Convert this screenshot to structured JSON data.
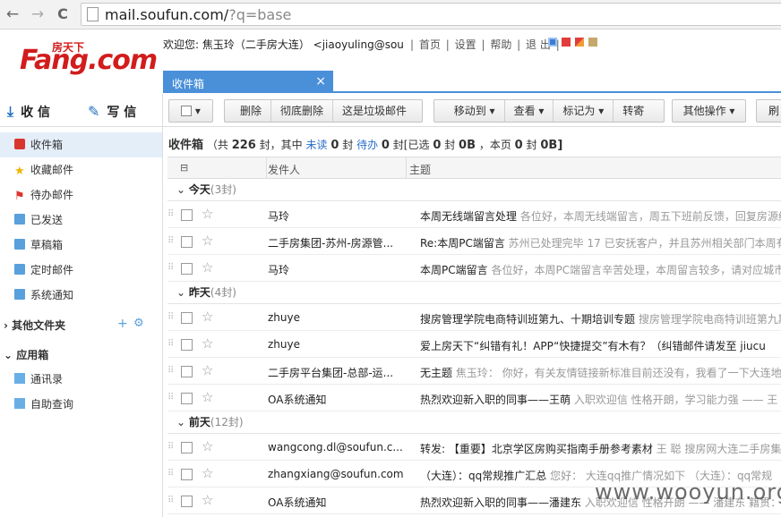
{
  "browser": {
    "url": "mail.soufun.com/",
    "url_query": "?q=base",
    "back": "←",
    "forward": "→",
    "reload": "C"
  },
  "logo": {
    "text": "Fang.com",
    "small": "房天下"
  },
  "header": {
    "welcome": "欢迎您: 焦玉玲（二手房大连） <jiaoyuling@sou",
    "links": [
      "首页",
      "设置",
      "帮助",
      "退 出"
    ],
    "sep": "|"
  },
  "tab": {
    "label": "收件箱",
    "close": "×"
  },
  "compose": {
    "receive": "收 信",
    "write": "写 信"
  },
  "sidebar": {
    "items": [
      "收件箱",
      "收藏邮件",
      "待办邮件",
      "已发送",
      "草稿箱",
      "定时邮件",
      "系统通知"
    ],
    "other_folders": "其他文件夹",
    "other_add": "+",
    "apps": "应用箱",
    "app_items": [
      "通讯录",
      "自助查询"
    ]
  },
  "toolbar": {
    "delete": "删除",
    "purge": "彻底删除",
    "spam": "这是垃圾邮件",
    "move": "移动到",
    "view": "查看",
    "mark": "标记为",
    "forward": "转寄",
    "more": "其他操作",
    "refresh": "刷"
  },
  "summary": {
    "title": "收件箱",
    "a": "（共",
    "total": "226",
    "b": "封，其中",
    "unread_l": "未读",
    "unread": "0",
    "c": "封",
    "todo_l": "待办",
    "todo": "0",
    "d": "封",
    "e": "[已选",
    "sel": "0",
    "f": "封",
    "size_sel": "0B",
    "g": "，本页",
    "page": "0",
    "h": "封",
    "size_page": "0B]"
  },
  "columns": {
    "sender": "发件人",
    "subject": "主题"
  },
  "groups": [
    {
      "label": "今天",
      "count": "(3封)"
    },
    {
      "label": "昨天",
      "count": "(4封)"
    },
    {
      "label": "前天",
      "count": "(12封)"
    }
  ],
  "rows": [
    {
      "sender": "马玲",
      "subject": "本周无线端留言处理",
      "preview": "各位好，本周无线端留言，周五下班前反馈，回复房源细"
    },
    {
      "sender": "二手房集团-苏州-房源管...",
      "subject": "Re:本周PC端留言",
      "preview": "苏州已处理完毕 17 已安抚客户，并且苏州相关部门本周有"
    },
    {
      "sender": "马玲",
      "subject": "本周PC端留言",
      "preview": "各位好，本周PC端留言辛苦处理，本周留言较多，请对应城市"
    },
    {
      "sender": "zhuye",
      "subject": "搜房管理学院电商特训班第九、十期培训专题",
      "preview": "搜房管理学院电商特训班第九期"
    },
    {
      "sender": "zhuye",
      "subject": "爱上房天下“纠错有礼！APP“快捷提交”有木有？（纠错邮件请发至 jiucu",
      "preview": ""
    },
    {
      "sender": "二手房平台集团-总部-运...",
      "subject": "无主题",
      "preview": "焦玉玲： 你好，有关友情链接新标准目前还没有，我看了一下大连地"
    },
    {
      "sender": "OA系统通知",
      "subject": "热烈欢迎新入职的同事——王萌",
      "preview": "入职欢迎信 性格开朗，学习能力强 —— 王"
    },
    {
      "sender": "wangcong.dl@soufun.c...",
      "subject": "转发: 【重要】北京学区房购买指南手册参考素材",
      "preview": "王 聪 搜房网大连二手房集团"
    },
    {
      "sender": "zhangxiang@soufun.com",
      "subject": "（大连）：qq常规推广汇总",
      "preview": "您好： 大连qq推广情况如下 （大连）：qq常规"
    },
    {
      "sender": "OA系统通知",
      "subject": "热烈欢迎新入职的同事——潘建东",
      "preview": "入职欢迎信 性格开朗 —— 潘建东 籍贯："
    }
  ],
  "watermark": "www.wooyun.org"
}
